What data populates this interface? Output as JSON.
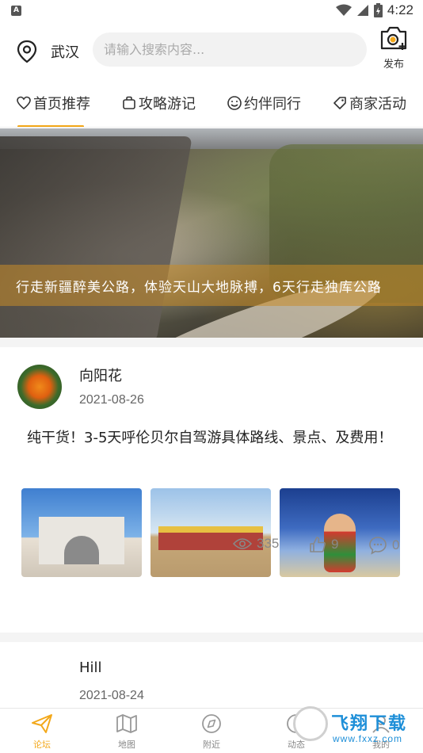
{
  "status_bar": {
    "time": "4:22",
    "notification_icon": "A"
  },
  "header": {
    "city": "武汉",
    "search_placeholder": "请输入搜索内容...",
    "publish_label": "发布"
  },
  "tabs": [
    {
      "label": "首页推荐",
      "icon": "heart-icon",
      "active": true
    },
    {
      "label": "攻略游记",
      "icon": "bag-icon",
      "active": false
    },
    {
      "label": "约伴同行",
      "icon": "smile-icon",
      "active": false
    },
    {
      "label": "商家活动",
      "icon": "tag-icon",
      "active": false
    }
  ],
  "accent_color": "#f3a81a",
  "banner": {
    "caption": "行走新疆醉美公路，体验天山大地脉搏，6天行走独库公路"
  },
  "posts": [
    {
      "author": "向阳花",
      "date": "2021-08-26",
      "text": "纯干货！3-5天呼伦贝尔自驾游具体路线、景点、及费用！",
      "views": "335",
      "likes": "9",
      "comments": "0"
    },
    {
      "author": "Hill",
      "date": "2021-08-24"
    }
  ],
  "bottom_nav": [
    {
      "label": "论坛",
      "icon": "paper-plane-icon",
      "active": true
    },
    {
      "label": "地图",
      "icon": "map-icon",
      "active": false
    },
    {
      "label": "附近",
      "icon": "compass-icon",
      "active": false
    },
    {
      "label": "动态",
      "icon": "activity-icon",
      "active": false
    },
    {
      "label": "我的",
      "icon": "user-icon",
      "active": false
    }
  ],
  "watermark": {
    "title": "飞翔下载",
    "url": "www.fxxz.com"
  }
}
